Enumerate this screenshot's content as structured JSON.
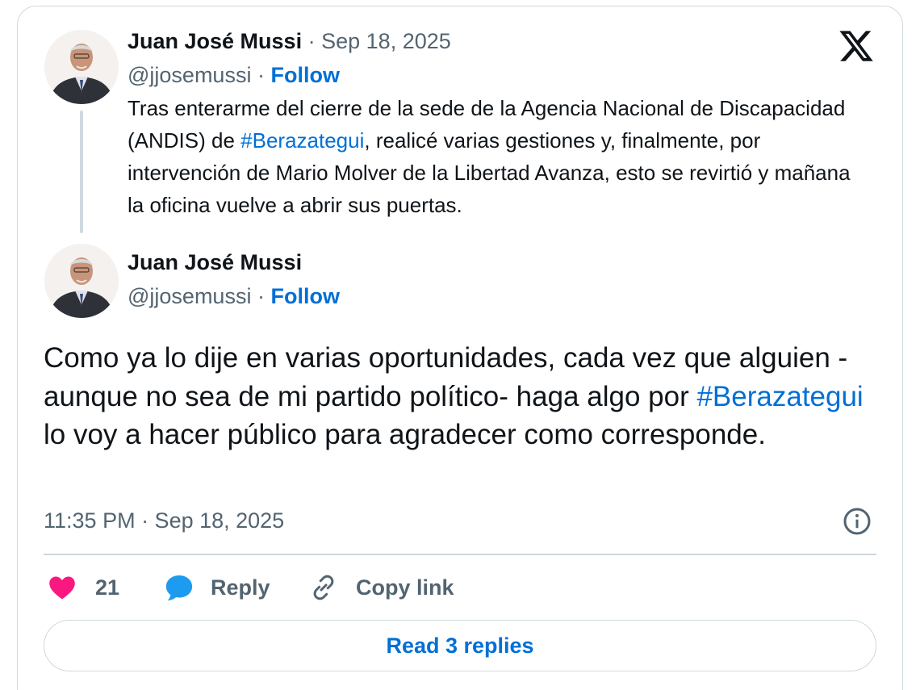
{
  "quoted": {
    "name": "Juan José Mussi",
    "separator": "·",
    "date": "Sep 18, 2025",
    "handle": "@jjosemussi",
    "follow": "Follow",
    "text_part1": "Tras enterarme del cierre de la sede de la Agencia Nacional de Discapacidad (ANDIS) de ",
    "hashtag": "#Berazategui",
    "text_part2": ", realicé varias gestiones y, finalmente, por intervención de Mario Molver de la Libertad Avanza, esto se revirtió y mañana la oficina vuelve a abrir sus puertas."
  },
  "main": {
    "name": "Juan José Mussi",
    "separator": "·",
    "handle": "@jjosemussi",
    "follow": "Follow",
    "text_part1": "Como ya lo dije en varias oportunidades, cada vez que alguien -aunque no sea de mi partido político- haga algo por ",
    "hashtag": "#Berazategui",
    "text_part2": " lo voy a hacer público para agradecer como corresponde.",
    "timestamp": "11:35 PM · Sep 18, 2025"
  },
  "actions": {
    "likes": "21",
    "reply": "Reply",
    "copy_link": "Copy link"
  },
  "read_replies": "Read 3 replies",
  "colors": {
    "link": "#006fd6",
    "like": "#f91880",
    "reply": "#1d9bf0",
    "muted": "#536471",
    "border": "#cfd9de"
  },
  "icons": [
    "x-logo-icon",
    "info-icon",
    "heart-icon",
    "reply-bubble-icon",
    "link-icon"
  ]
}
